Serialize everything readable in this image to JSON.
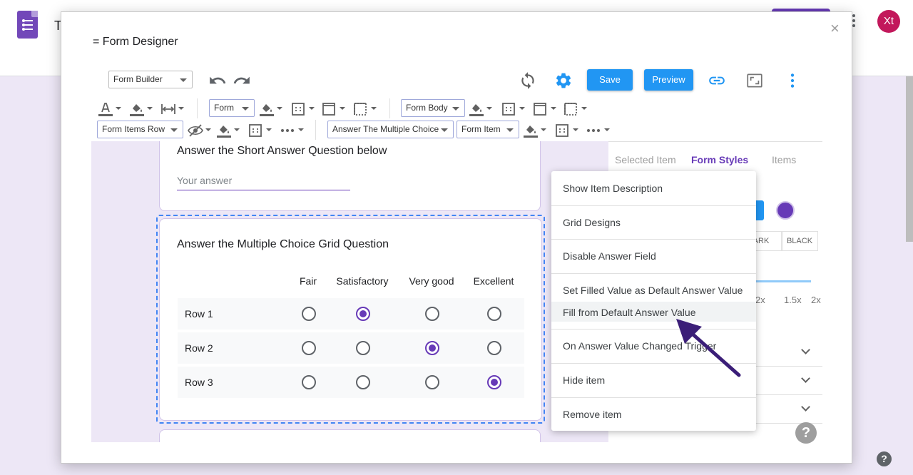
{
  "background": {
    "title": "T",
    "avatar": "Xt",
    "help": "?"
  },
  "dialog": {
    "title": "= Form Designer",
    "close": "×"
  },
  "toolbar": {
    "mode_select": "Form Builder",
    "save": "Save",
    "preview": "Preview",
    "icons": [
      "undo-icon",
      "redo-icon",
      "refresh-icon",
      "settings-icon",
      "link-icon",
      "fullscreen-icon",
      "more-vert-icon"
    ]
  },
  "style_bar": {
    "row1": {
      "form_select": "Form",
      "form_body_select": "Form Body"
    },
    "row2": {
      "form_items_row_select": "Form Items Row",
      "question_select": "Answer The Multiple Choice",
      "form_item_select": "Form Item"
    }
  },
  "canvas": {
    "short_answer": {
      "question": "Answer the Short Answer Question below",
      "placeholder": "Your answer"
    },
    "grid_question": {
      "question": "Answer the Multiple Choice Grid Question",
      "columns": [
        "Fair",
        "Satisfactory",
        "Very good",
        "Excellent"
      ],
      "rows": [
        {
          "label": "Row 1",
          "selected": 1
        },
        {
          "label": "Row 2",
          "selected": 2
        },
        {
          "label": "Row 3",
          "selected": 3
        }
      ]
    }
  },
  "panel": {
    "tabs": [
      "Selected Item",
      "Form Styles",
      "Items"
    ],
    "active_tab": "Form Styles",
    "theme_dark": "DARK",
    "theme_black": "BLACK",
    "scale_labels": [
      "2x",
      "1.5x",
      "2x"
    ],
    "help": "?",
    "colors": {
      "accent": "#673ab7",
      "blue": "#2196f3"
    }
  },
  "context_menu": {
    "items": [
      "Show Item Description",
      "Grid Designs",
      "Disable Answer Field",
      "Set Filled Value as Default Answer Value",
      "Fill from Default Answer Value",
      "On Answer Value Changed Trigger",
      "Hide item",
      "Remove item"
    ],
    "highlighted": "Fill from Default Answer Value"
  }
}
